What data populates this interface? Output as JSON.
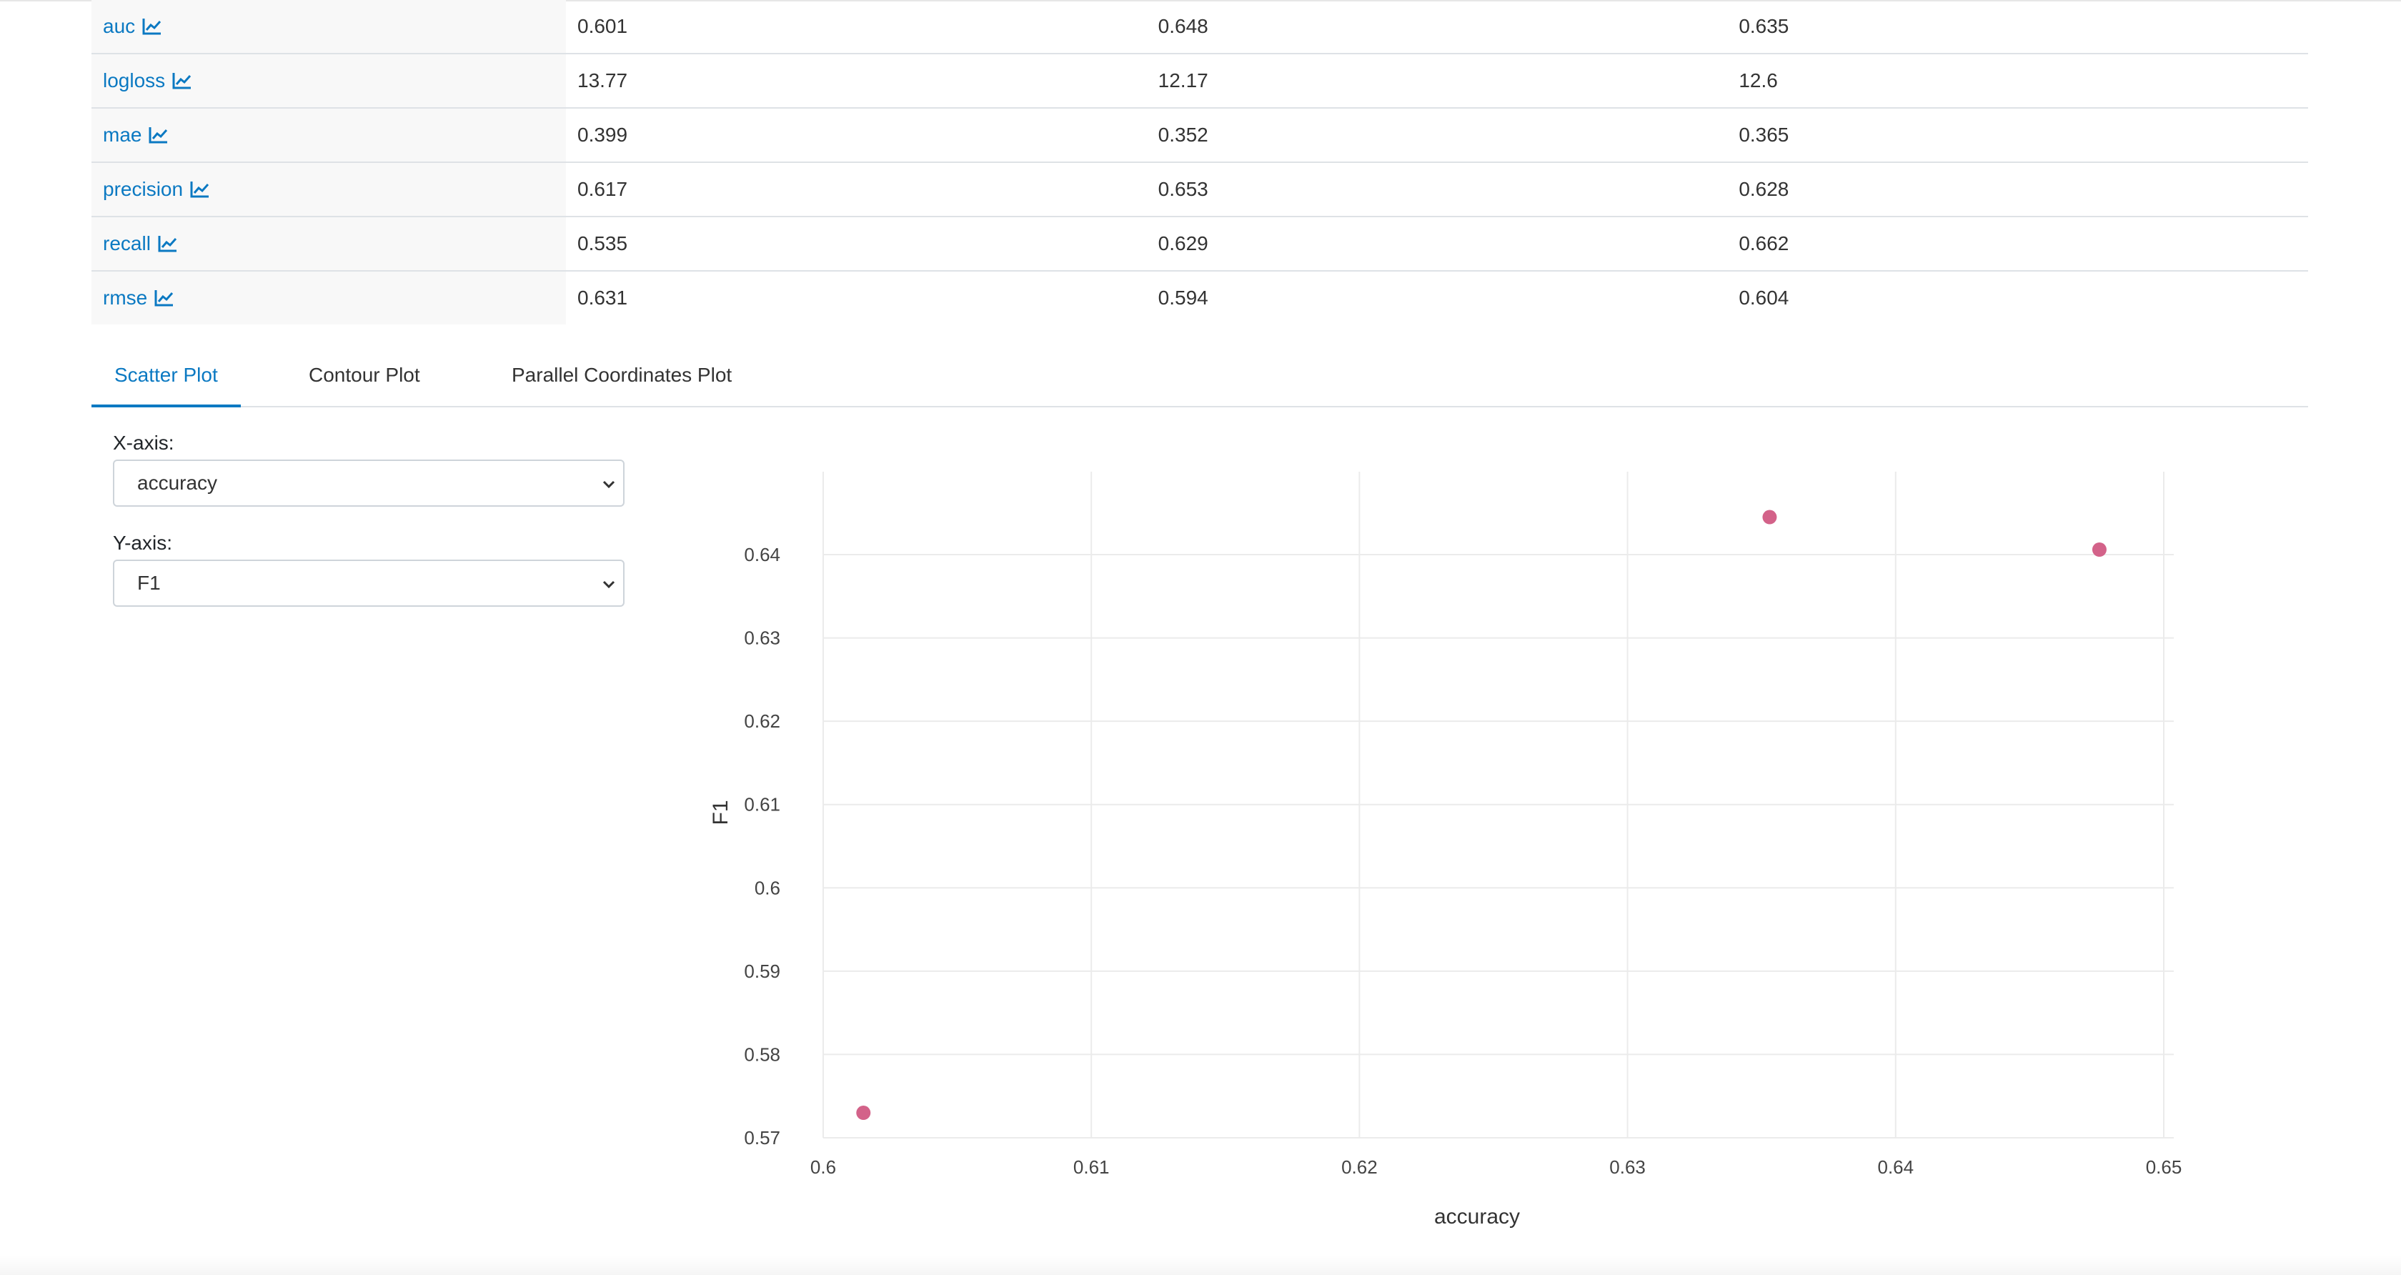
{
  "metrics_table": {
    "rows": [
      {
        "name": "auc",
        "values": [
          "0.601",
          "0.648",
          "0.635"
        ]
      },
      {
        "name": "logloss",
        "values": [
          "13.77",
          "12.17",
          "12.6"
        ]
      },
      {
        "name": "mae",
        "values": [
          "0.399",
          "0.352",
          "0.365"
        ]
      },
      {
        "name": "precision",
        "values": [
          "0.617",
          "0.653",
          "0.628"
        ]
      },
      {
        "name": "recall",
        "values": [
          "0.535",
          "0.629",
          "0.662"
        ]
      },
      {
        "name": "rmse",
        "values": [
          "0.631",
          "0.594",
          "0.604"
        ]
      }
    ],
    "metric_icon": "line-chart-icon"
  },
  "tabs": [
    {
      "label": "Scatter Plot",
      "active": true
    },
    {
      "label": "Contour Plot",
      "active": false
    },
    {
      "label": "Parallel Coordinates Plot",
      "active": false
    }
  ],
  "controls": {
    "x_axis_label": "X-axis:",
    "x_axis_value": "accuracy",
    "y_axis_label": "Y-axis:",
    "y_axis_value": "F1"
  },
  "colors": {
    "link": "#0b79c2",
    "point": "#d36289",
    "grid": "#ebebeb"
  },
  "chart_data": {
    "type": "scatter",
    "xlabel": "accuracy",
    "ylabel": "F1",
    "xlim": [
      0.6,
      0.65
    ],
    "ylim": [
      0.57,
      0.645
    ],
    "x_ticks": [
      0.6,
      0.61,
      0.62,
      0.63,
      0.64,
      0.65
    ],
    "x_tick_labels": [
      "0.6",
      "0.61",
      "0.62",
      "0.63",
      "0.64",
      "0.65"
    ],
    "y_ticks": [
      0.57,
      0.58,
      0.59,
      0.6,
      0.61,
      0.62,
      0.63,
      0.64
    ],
    "y_tick_labels": [
      "0.57",
      "0.58",
      "0.59",
      "0.6",
      "0.61",
      "0.62",
      "0.63",
      "0.64"
    ],
    "grid": true,
    "points": [
      {
        "x": 0.6015,
        "y": 0.573
      },
      {
        "x": 0.6353,
        "y": 0.6445
      },
      {
        "x": 0.6476,
        "y": 0.6406
      }
    ]
  }
}
